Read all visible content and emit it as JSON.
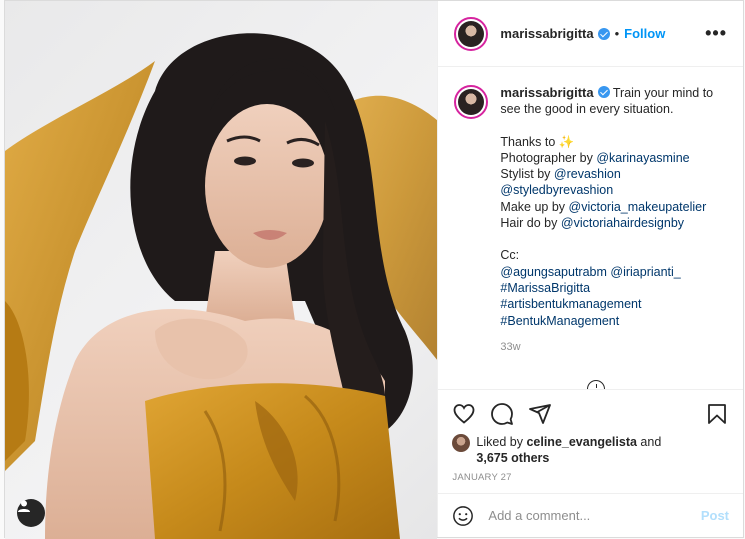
{
  "header": {
    "username": "marissabrigitta",
    "separator": "•",
    "follow_label": "Follow",
    "more_label": "•••"
  },
  "caption": {
    "username": "marissabrigitta",
    "line1": "Train your mind to see the good in every situation.",
    "thanks_prefix": "Thanks to",
    "thanks_emoji": "✨",
    "photographer_prefix": "Photographer by",
    "photographer_tag": "@karinayasmine",
    "stylist_prefix": "Stylist by",
    "stylist_tag1": "@revashion",
    "stylist_tag2": "@styledbyrevashion",
    "makeup_prefix": "Make up by",
    "makeup_tag": "@victoria_makeupatelier",
    "hair_prefix": "Hair do by",
    "hair_tag": "@victoriahairdesignby",
    "cc_label": "Cc:",
    "cc_tag1": "@agungsaputrabm",
    "cc_tag2": "@iriaprianti_",
    "hashtag1": "#MarissaBrigitta",
    "hashtag2": "#artisbentukmanagement",
    "hashtag3": "#BentukManagement",
    "time": "33w"
  },
  "icons": [
    "heart-icon",
    "comment-icon",
    "share-icon",
    "bookmark-icon",
    "emoji-icon",
    "user-tag-icon"
  ],
  "likes": {
    "prefix": "Liked by",
    "user": "celine_evangelista",
    "and": "and",
    "others": "3,675 others"
  },
  "date": "JANUARY 27",
  "comment_box": {
    "placeholder": "Add a comment...",
    "post_label": "Post"
  },
  "colors": {
    "accent_blue": "#0095f6",
    "post_disabled": "#b2dffc",
    "dress_mustard": "#c8901e",
    "story_ring": "#d6249f"
  }
}
